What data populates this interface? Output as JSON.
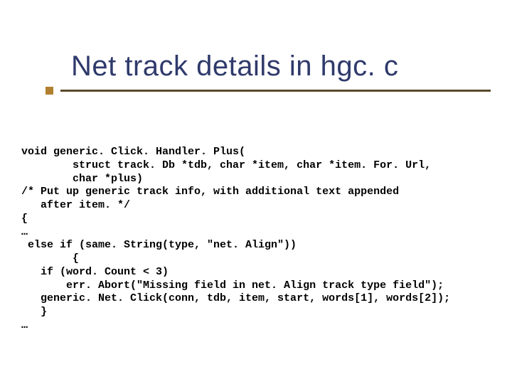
{
  "title": "Net track details in hgc. c",
  "code_lines": [
    "void generic. Click. Handler. Plus(",
    "        struct track. Db *tdb, char *item, char *item. For. Url,",
    "        char *plus)",
    "/* Put up generic track info, with additional text appended",
    "   after item. */",
    "{",
    "…",
    " else if (same. String(type, \"net. Align\"))",
    "        {",
    "   if (word. Count < 3)",
    "       err. Abort(\"Missing field in net. Align track type field\");",
    "   generic. Net. Click(conn, tdb, item, start, words[1], words[2]);",
    "   }",
    "…"
  ]
}
